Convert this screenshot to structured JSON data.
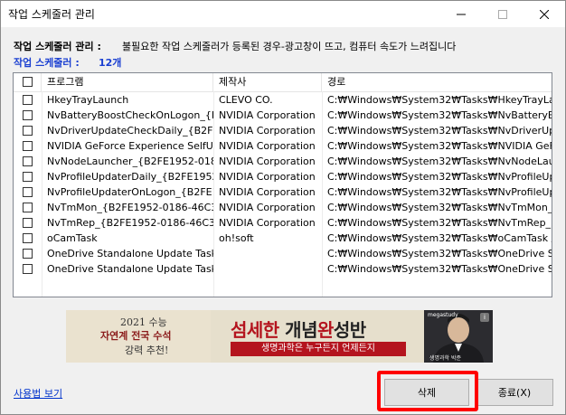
{
  "window": {
    "title": "작업 스케줄러 관리",
    "minimize_icon": "minimize-icon",
    "maximize_icon": "maximize-icon",
    "close_icon": "close-icon"
  },
  "info": {
    "label": "작업 스케줄러 관리 :",
    "description": "불필요한 작업 스케줄러가 등록된 경우-광고창이 뜨고, 컴퓨터 속도가 느려집니다",
    "count_label": "작업 스케줄러 :",
    "count_value": "12개"
  },
  "table": {
    "columns": [
      "프로그램",
      "제작사",
      "경로"
    ],
    "rows": [
      {
        "program": "HkeyTrayLaunch",
        "vendor": "CLEVO CO.",
        "path": "C:₩Windows₩System32₩Tasks₩HkeyTrayLa..."
      },
      {
        "program": "NvBatteryBoostCheckOnLogon_{B...",
        "vendor": "NVIDIA Corporation",
        "path": "C:₩Windows₩System32₩Tasks₩NvBatteryB..."
      },
      {
        "program": "NvDriverUpdateCheckDaily_{B2FE...",
        "vendor": "NVIDIA Corporation",
        "path": "C:₩Windows₩System32₩Tasks₩NvDriverUp..."
      },
      {
        "program": "NVIDIA GeForce Experience SelfU...",
        "vendor": "NVIDIA Corporation",
        "path": "C:₩Windows₩System32₩Tasks₩NVIDIA GeF..."
      },
      {
        "program": "NvNodeLauncher_{B2FE1952-018...",
        "vendor": "NVIDIA Corporation",
        "path": "C:₩Windows₩System32₩Tasks₩NvNodeLau..."
      },
      {
        "program": "NvProfileUpdaterDaily_{B2FE1952...",
        "vendor": "NVIDIA Corporation",
        "path": "C:₩Windows₩System32₩Tasks₩NvProfileUp..."
      },
      {
        "program": "NvProfileUpdaterOnLogon_{B2FE1...",
        "vendor": "NVIDIA Corporation",
        "path": "C:₩Windows₩System32₩Tasks₩NvProfileUp..."
      },
      {
        "program": "NvTmMon_{B2FE1952-0186-46C3-...",
        "vendor": "NVIDIA Corporation",
        "path": "C:₩Windows₩System32₩Tasks₩NvTmMon_{..."
      },
      {
        "program": "NvTmRep_{B2FE1952-0186-46C3-...",
        "vendor": "NVIDIA Corporation",
        "path": "C:₩Windows₩System32₩Tasks₩NvTmRep_{..."
      },
      {
        "program": "oCamTask",
        "vendor": "oh!soft",
        "path": "C:₩Windows₩System32₩Tasks₩oCamTask /..."
      },
      {
        "program": "OneDrive Standalone Update Task...",
        "vendor": "",
        "path": "C:₩Windows₩System32₩Tasks₩OneDrive St..."
      },
      {
        "program": "OneDrive Standalone Update Task...",
        "vendor": "",
        "path": "C:₩Windows₩System32₩Tasks₩OneDrive St..."
      }
    ]
  },
  "banner": {
    "line1": "2021 수능",
    "line2": "자연계 전국 수석",
    "line3": "강력 추천!",
    "main_a": "섬세한 ",
    "main_b": "개념",
    "main_c": "완",
    "main_d": "성반",
    "sub": "생명과학은 누구든지 언제든지",
    "brand": "megastudy",
    "caption": "생명과학 박준"
  },
  "footer": {
    "help_link": "사용법 보기",
    "delete_button": "삭제",
    "close_button": "종료(X)"
  },
  "colors": {
    "accent_blue": "#1a3fd1",
    "highlight_red": "#ff0000",
    "banner_red": "#b4141e"
  }
}
